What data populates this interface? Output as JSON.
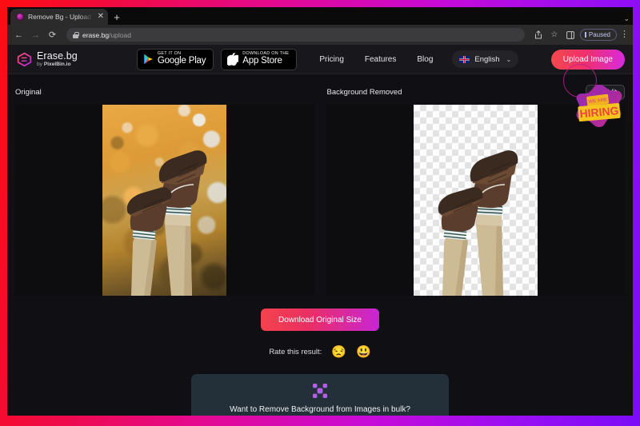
{
  "browser": {
    "tab": {
      "title": "Remove Bg - Upload Images to",
      "favicon": "erasebg-favicon",
      "close_label": "✕"
    },
    "new_tab_label": "+",
    "tabstrip_expand": "⌄",
    "nav": {
      "back": "←",
      "forward": "→",
      "reload": "⟳"
    },
    "omnibox": {
      "domain": "erase.bg",
      "path": "/upload",
      "lock": "lock-icon"
    },
    "toolbar_icons": {
      "share": "⇧",
      "bookmark": "☆",
      "side_panel": "▣"
    },
    "profile": {
      "status_label": "Paused"
    },
    "menu_label": "⋮"
  },
  "header": {
    "brand": {
      "name": "Erase.bg",
      "by": "by",
      "company": "PixelBin.io"
    },
    "badges": [
      {
        "small": "GET IT ON",
        "big": "Google Play",
        "icon": "google-play-icon"
      },
      {
        "small": "Download on the",
        "big": "App Store",
        "icon": "apple-icon"
      }
    ],
    "nav_links": [
      "Pricing",
      "Features",
      "Blog"
    ],
    "language": {
      "label": "English",
      "flag": "uk-flag-icon",
      "chevron": "⌄"
    },
    "upload_button": "Upload Image"
  },
  "hiring_badge": {
    "line1": "WE ARE",
    "line2": "HIRING"
  },
  "main": {
    "original": {
      "title": "Original"
    },
    "result": {
      "title": "Background Removed",
      "edit_button": "Edit",
      "edit_icon": "pencil-icon"
    },
    "download_button": "Download Original Size",
    "rating": {
      "label": "Rate this result:",
      "options": [
        {
          "name": "sad-emoji",
          "glyph": "😒"
        },
        {
          "name": "happy-emoji",
          "glyph": "😃"
        }
      ]
    },
    "bulk_card": {
      "logo": "pixelbin-x-icon",
      "text": "Want to Remove Background from Images in bulk?"
    }
  },
  "colors": {
    "frame_start": "#fd0d12",
    "frame_mid": "#e5098f",
    "frame_end": "#7c0bf7",
    "accent_gradient_start": "#f4434c",
    "accent_gradient_end": "#c726d6",
    "page_bg": "#101014",
    "header_bg": "#18181c",
    "bulk_card_bg": "#243039"
  }
}
